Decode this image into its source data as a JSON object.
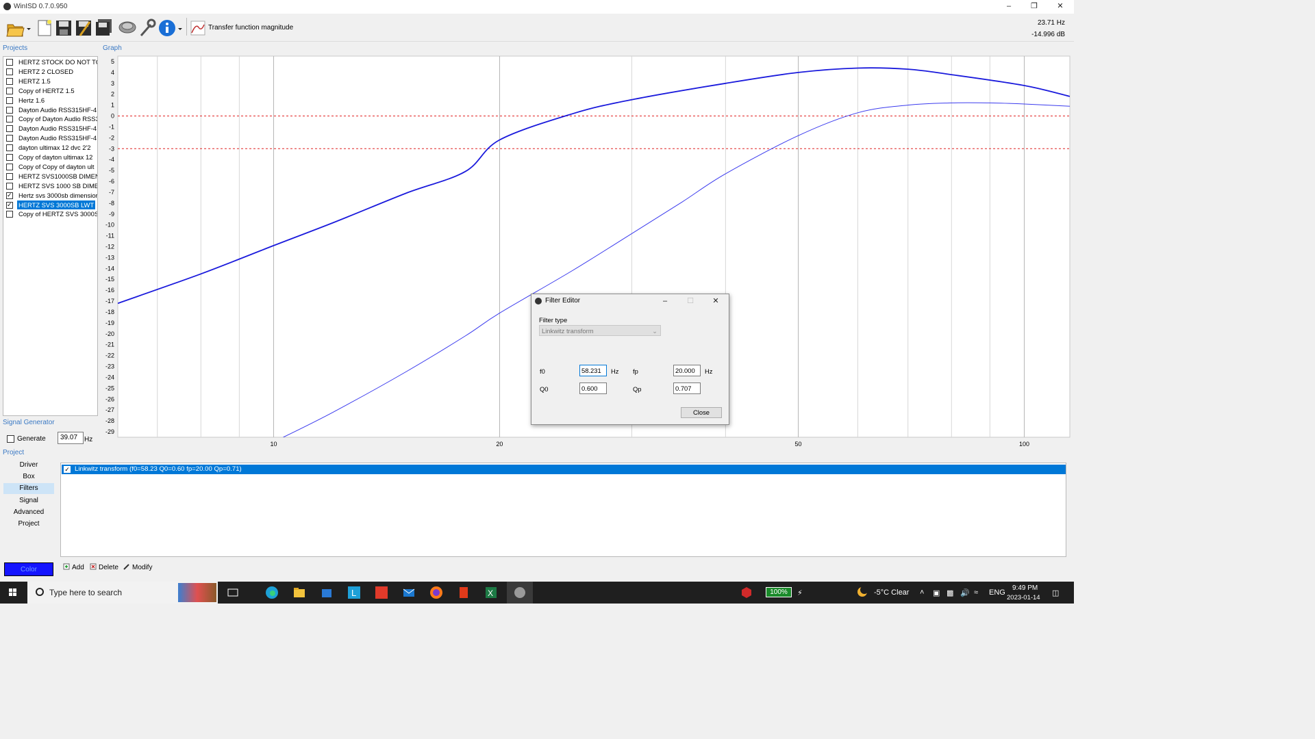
{
  "window": {
    "title": "WinISD 0.7.0.950",
    "min": "–",
    "restore": "❐",
    "close": "✕"
  },
  "toolbar": {
    "icons": [
      "open-folder-icon",
      "new-project-icon",
      "save-icon",
      "save-as-icon",
      "save-all-icon",
      "driver-icon",
      "settings-wrench-icon",
      "info-icon",
      "graph-type-icon"
    ],
    "graph_type_label": "Transfer function magnitude",
    "readout_freq": "23.71 Hz",
    "readout_db": "-14.996 dB"
  },
  "projects": {
    "header": "Projects",
    "items": [
      {
        "label": "HERTZ STOCK DO NOT TOU",
        "checked": false,
        "selected": false
      },
      {
        "label": "HERTZ 2 CLOSED",
        "checked": false,
        "selected": false
      },
      {
        "label": "HERTZ 1.5",
        "checked": false,
        "selected": false
      },
      {
        "label": "Copy of HERTZ 1.5",
        "checked": false,
        "selected": false
      },
      {
        "label": "Hertz 1.6",
        "checked": false,
        "selected": false
      },
      {
        "label": "Dayton Audio RSS315HF-4",
        "checked": false,
        "selected": false
      },
      {
        "label": "Copy of Dayton Audio RSS3",
        "checked": false,
        "selected": false
      },
      {
        "label": "Dayton Audio RSS315HF-4",
        "checked": false,
        "selected": false
      },
      {
        "label": "Dayton Audio RSS315HF-4",
        "checked": false,
        "selected": false
      },
      {
        "label": "dayton ultimax 12 dvc 2'2",
        "checked": false,
        "selected": false
      },
      {
        "label": "Copy of dayton ultimax 12",
        "checked": false,
        "selected": false
      },
      {
        "label": "Copy of Copy of dayton ult",
        "checked": false,
        "selected": false
      },
      {
        "label": "HERTZ SVS1000SB DIMENSI",
        "checked": false,
        "selected": false
      },
      {
        "label": "HERTZ SVS 1000 SB DIMENS",
        "checked": false,
        "selected": false
      },
      {
        "label": "Hertz svs 3000sb dimensior",
        "checked": true,
        "selected": false
      },
      {
        "label": "HERTZ SVS 3000SB  LWT",
        "checked": true,
        "selected": true
      },
      {
        "label": "Copy of HERTZ SVS 3000SB",
        "checked": false,
        "selected": false
      }
    ]
  },
  "graph": {
    "header": "Graph"
  },
  "signal_generator": {
    "header": "Signal Generator",
    "generate_label": "Generate",
    "generate_checked": false,
    "frequency": "39.07",
    "unit": "Hz"
  },
  "project_panel": {
    "header": "Project",
    "nav": [
      "Driver",
      "Box",
      "Filters",
      "Signal",
      "Advanced",
      "Project"
    ],
    "active_nav": "Filters",
    "filter_row": "Linkwitz transform (f0=58.23 Q0=0.60 fp=20.00 Qp=0.71)",
    "color_button": "Color",
    "color_value": "#1414ff",
    "actions": {
      "add": "Add",
      "delete": "Delete",
      "modify": "Modify"
    }
  },
  "dialog": {
    "title": "Filter Editor",
    "filter_type_label": "Filter type",
    "filter_type_value": "Linkwitz transform",
    "f0_label": "f0",
    "f0_value": "58.231",
    "f0_unit": "Hz",
    "fp_label": "fp",
    "fp_value": "20.000",
    "fp_unit": "Hz",
    "q0_label": "Q0",
    "q0_value": "0.600",
    "qp_label": "Qp",
    "qp_value": "0.707",
    "close_button": "Close"
  },
  "taskbar": {
    "search_placeholder": "Type here to search",
    "battery": "100%",
    "weather": "-5°C  Clear",
    "language": "ENG",
    "time": "9:49 PM",
    "date": "2023-01-14"
  },
  "chart_data": {
    "type": "line",
    "title": "",
    "xlabel": "",
    "ylabel": "",
    "xscale": "log",
    "xlim": [
      6.2,
      115
    ],
    "ylim": [
      -29.5,
      5.5
    ],
    "x_ticks": [
      10,
      20,
      50,
      100
    ],
    "y_ticks": [
      5,
      4,
      3,
      2,
      1,
      0,
      -1,
      -2,
      -3,
      -4,
      -5,
      -6,
      -7,
      -8,
      -9,
      -10,
      -11,
      -12,
      -13,
      -14,
      -15,
      -16,
      -17,
      -18,
      -19,
      -20,
      -21,
      -22,
      -23,
      -24,
      -25,
      -26,
      -27,
      -28,
      -29
    ],
    "grid": true,
    "reference_lines": [
      0,
      -3
    ],
    "series": [
      {
        "color": "#1a1adc",
        "x": [
          6.2,
          8,
          10,
          12,
          15,
          18,
          20,
          25,
          30,
          40,
          50,
          60,
          70,
          80,
          100,
          115
        ],
        "y": [
          -17.2,
          -14.5,
          -11.9,
          -9.8,
          -7.1,
          -5.1,
          -2.2,
          0.2,
          1.5,
          3.0,
          4.0,
          4.4,
          4.3,
          3.8,
          2.8,
          1.8
        ]
      },
      {
        "color": "#3a3aee",
        "x": [
          10.3,
          12,
          15,
          18,
          20,
          25,
          30,
          35,
          40,
          50,
          60,
          70,
          80,
          90,
          100,
          115
        ],
        "y": [
          -29.5,
          -27.2,
          -23.5,
          -20.2,
          -18.1,
          -14.2,
          -10.8,
          -7.9,
          -5.3,
          -1.8,
          0.3,
          1.0,
          1.2,
          1.2,
          1.1,
          0.9
        ]
      }
    ]
  }
}
